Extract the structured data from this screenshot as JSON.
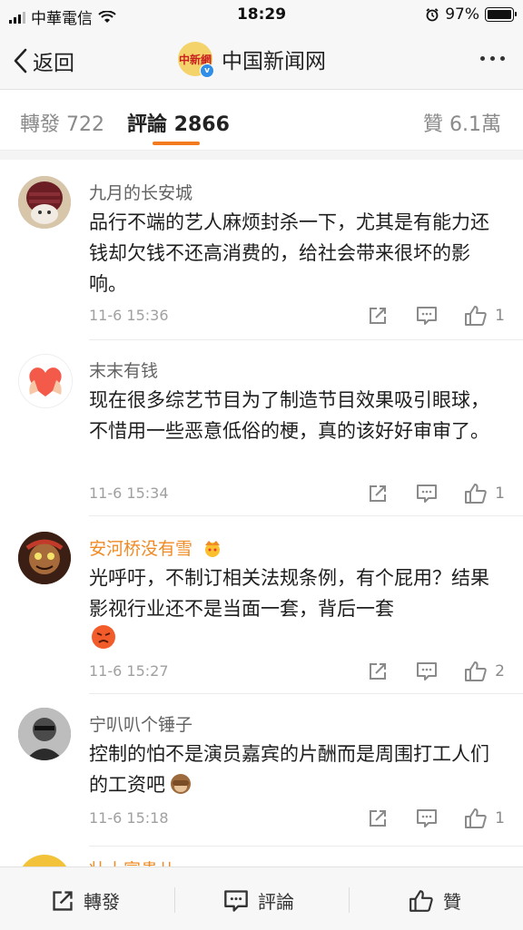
{
  "status": {
    "carrier": "中華電信",
    "time": "18:29",
    "battery": "97%"
  },
  "nav": {
    "back_label": "返回",
    "title": "中国新闻网",
    "logo_text": "中新網"
  },
  "tabs": {
    "repost": "轉發 722",
    "comments": "評論 2866",
    "likes": "贊 6.1萬"
  },
  "comments": [
    {
      "user": "九月的长安城",
      "text": "品行不端的艺人麻烦封杀一下，尤其是有能力还钱却欠钱不还高消费的，给社会带来很坏的影响。",
      "time": "11-6 15:36",
      "likes": "1"
    },
    {
      "user": "末末有钱",
      "text": "现在很多综艺节目为了制造节目效果吸引眼球，不惜用一些恶意低俗的梗，真的该好好审审了。",
      "time": "11-6 15:34",
      "likes": "1"
    },
    {
      "user": "安河桥没有雪",
      "text": "光呼吁，不制订相关法规条例，有个屁用？结果影视行业还不是当面一套，背后一套",
      "time": "11-6 15:27",
      "likes": "2"
    },
    {
      "user": "宁叭叭个锤子",
      "text": "控制的怕不是演员嘉宾的片酬而是周围打工人们的工资吧",
      "time": "11-6 15:18",
      "likes": "1"
    },
    {
      "user": "壮士富贵儿"
    }
  ],
  "bottom": {
    "repost": "轉發",
    "comment": "評論",
    "like": "贊"
  },
  "colors": {
    "accent": "#f47a1f",
    "vip_name": "#f08a24"
  }
}
